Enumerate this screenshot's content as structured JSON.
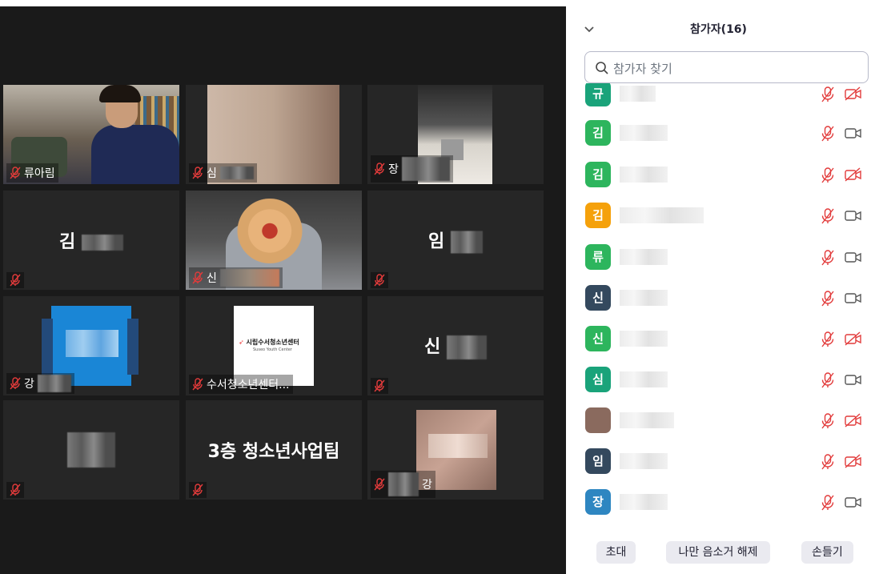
{
  "video": {
    "tiles": [
      {
        "id": "t1",
        "label": "류아림",
        "center": ""
      },
      {
        "id": "t2",
        "label": "심",
        "center": ""
      },
      {
        "id": "t3",
        "label": "장",
        "center": ""
      },
      {
        "id": "t4",
        "label": "",
        "center": "김"
      },
      {
        "id": "t5",
        "label": "신",
        "center": ""
      },
      {
        "id": "t6",
        "label": "",
        "center": "임"
      },
      {
        "id": "t7",
        "label": "강",
        "center": ""
      },
      {
        "id": "t8",
        "label": "수서청소년센터...",
        "center": ""
      },
      {
        "id": "t9",
        "label": "",
        "center": "신"
      },
      {
        "id": "t10",
        "label": "",
        "center": ""
      },
      {
        "id": "t11",
        "label": "",
        "center": "3층 청소년사업팀"
      },
      {
        "id": "t12",
        "label": "강",
        "center": ""
      }
    ],
    "logo_text": "시립수서청소년센터",
    "logo_sub": "Suseo Youth Center"
  },
  "panel": {
    "title": "참가자(16)",
    "search_placeholder": "참가자 찾기",
    "participants": [
      {
        "initial": "규",
        "color": "#1aa37a",
        "cam_off": true
      },
      {
        "initial": "김",
        "color": "#2db55d",
        "cam_off": false
      },
      {
        "initial": "김",
        "color": "#2db55d",
        "cam_off": true
      },
      {
        "initial": "김",
        "color": "#f5a10b",
        "cam_off": false
      },
      {
        "initial": "류",
        "color": "#2db55d",
        "cam_off": false
      },
      {
        "initial": "신",
        "color": "#34495e",
        "cam_off": false
      },
      {
        "initial": "신",
        "color": "#2db55d",
        "cam_off": true
      },
      {
        "initial": "심",
        "color": "#1aa37a",
        "cam_off": false
      },
      {
        "initial": "",
        "color": "#8a6a5e",
        "cam_off": true
      },
      {
        "initial": "임",
        "color": "#34495e",
        "cam_off": true
      },
      {
        "initial": "장",
        "color": "#2e86c1",
        "cam_off": false
      }
    ],
    "buttons": {
      "invite": "초대",
      "unmute_self": "나만 음소거 해제",
      "raise_hand": "손들기"
    }
  }
}
